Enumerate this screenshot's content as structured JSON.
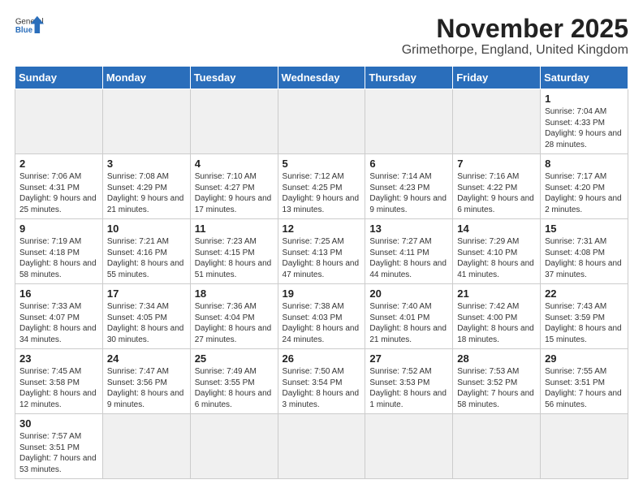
{
  "header": {
    "title": "November 2025",
    "subtitle": "Grimethorpe, England, United Kingdom",
    "logo_general": "General",
    "logo_blue": "Blue"
  },
  "days_of_week": [
    "Sunday",
    "Monday",
    "Tuesday",
    "Wednesday",
    "Thursday",
    "Friday",
    "Saturday"
  ],
  "weeks": [
    [
      {
        "day": "",
        "info": ""
      },
      {
        "day": "",
        "info": ""
      },
      {
        "day": "",
        "info": ""
      },
      {
        "day": "",
        "info": ""
      },
      {
        "day": "",
        "info": ""
      },
      {
        "day": "",
        "info": ""
      },
      {
        "day": "1",
        "info": "Sunrise: 7:04 AM\nSunset: 4:33 PM\nDaylight: 9 hours\nand 28 minutes."
      }
    ],
    [
      {
        "day": "2",
        "info": "Sunrise: 7:06 AM\nSunset: 4:31 PM\nDaylight: 9 hours\nand 25 minutes."
      },
      {
        "day": "3",
        "info": "Sunrise: 7:08 AM\nSunset: 4:29 PM\nDaylight: 9 hours\nand 21 minutes."
      },
      {
        "day": "4",
        "info": "Sunrise: 7:10 AM\nSunset: 4:27 PM\nDaylight: 9 hours\nand 17 minutes."
      },
      {
        "day": "5",
        "info": "Sunrise: 7:12 AM\nSunset: 4:25 PM\nDaylight: 9 hours\nand 13 minutes."
      },
      {
        "day": "6",
        "info": "Sunrise: 7:14 AM\nSunset: 4:23 PM\nDaylight: 9 hours\nand 9 minutes."
      },
      {
        "day": "7",
        "info": "Sunrise: 7:16 AM\nSunset: 4:22 PM\nDaylight: 9 hours\nand 6 minutes."
      },
      {
        "day": "8",
        "info": "Sunrise: 7:17 AM\nSunset: 4:20 PM\nDaylight: 9 hours\nand 2 minutes."
      }
    ],
    [
      {
        "day": "9",
        "info": "Sunrise: 7:19 AM\nSunset: 4:18 PM\nDaylight: 8 hours\nand 58 minutes."
      },
      {
        "day": "10",
        "info": "Sunrise: 7:21 AM\nSunset: 4:16 PM\nDaylight: 8 hours\nand 55 minutes."
      },
      {
        "day": "11",
        "info": "Sunrise: 7:23 AM\nSunset: 4:15 PM\nDaylight: 8 hours\nand 51 minutes."
      },
      {
        "day": "12",
        "info": "Sunrise: 7:25 AM\nSunset: 4:13 PM\nDaylight: 8 hours\nand 47 minutes."
      },
      {
        "day": "13",
        "info": "Sunrise: 7:27 AM\nSunset: 4:11 PM\nDaylight: 8 hours\nand 44 minutes."
      },
      {
        "day": "14",
        "info": "Sunrise: 7:29 AM\nSunset: 4:10 PM\nDaylight: 8 hours\nand 41 minutes."
      },
      {
        "day": "15",
        "info": "Sunrise: 7:31 AM\nSunset: 4:08 PM\nDaylight: 8 hours\nand 37 minutes."
      }
    ],
    [
      {
        "day": "16",
        "info": "Sunrise: 7:33 AM\nSunset: 4:07 PM\nDaylight: 8 hours\nand 34 minutes."
      },
      {
        "day": "17",
        "info": "Sunrise: 7:34 AM\nSunset: 4:05 PM\nDaylight: 8 hours\nand 30 minutes."
      },
      {
        "day": "18",
        "info": "Sunrise: 7:36 AM\nSunset: 4:04 PM\nDaylight: 8 hours\nand 27 minutes."
      },
      {
        "day": "19",
        "info": "Sunrise: 7:38 AM\nSunset: 4:03 PM\nDaylight: 8 hours\nand 24 minutes."
      },
      {
        "day": "20",
        "info": "Sunrise: 7:40 AM\nSunset: 4:01 PM\nDaylight: 8 hours\nand 21 minutes."
      },
      {
        "day": "21",
        "info": "Sunrise: 7:42 AM\nSunset: 4:00 PM\nDaylight: 8 hours\nand 18 minutes."
      },
      {
        "day": "22",
        "info": "Sunrise: 7:43 AM\nSunset: 3:59 PM\nDaylight: 8 hours\nand 15 minutes."
      }
    ],
    [
      {
        "day": "23",
        "info": "Sunrise: 7:45 AM\nSunset: 3:58 PM\nDaylight: 8 hours\nand 12 minutes."
      },
      {
        "day": "24",
        "info": "Sunrise: 7:47 AM\nSunset: 3:56 PM\nDaylight: 8 hours\nand 9 minutes."
      },
      {
        "day": "25",
        "info": "Sunrise: 7:49 AM\nSunset: 3:55 PM\nDaylight: 8 hours\nand 6 minutes."
      },
      {
        "day": "26",
        "info": "Sunrise: 7:50 AM\nSunset: 3:54 PM\nDaylight: 8 hours\nand 3 minutes."
      },
      {
        "day": "27",
        "info": "Sunrise: 7:52 AM\nSunset: 3:53 PM\nDaylight: 8 hours\nand 1 minute."
      },
      {
        "day": "28",
        "info": "Sunrise: 7:53 AM\nSunset: 3:52 PM\nDaylight: 7 hours\nand 58 minutes."
      },
      {
        "day": "29",
        "info": "Sunrise: 7:55 AM\nSunset: 3:51 PM\nDaylight: 7 hours\nand 56 minutes."
      }
    ],
    [
      {
        "day": "30",
        "info": "Sunrise: 7:57 AM\nSunset: 3:51 PM\nDaylight: 7 hours\nand 53 minutes."
      },
      {
        "day": "",
        "info": ""
      },
      {
        "day": "",
        "info": ""
      },
      {
        "day": "",
        "info": ""
      },
      {
        "day": "",
        "info": ""
      },
      {
        "day": "",
        "info": ""
      },
      {
        "day": "",
        "info": ""
      }
    ]
  ]
}
